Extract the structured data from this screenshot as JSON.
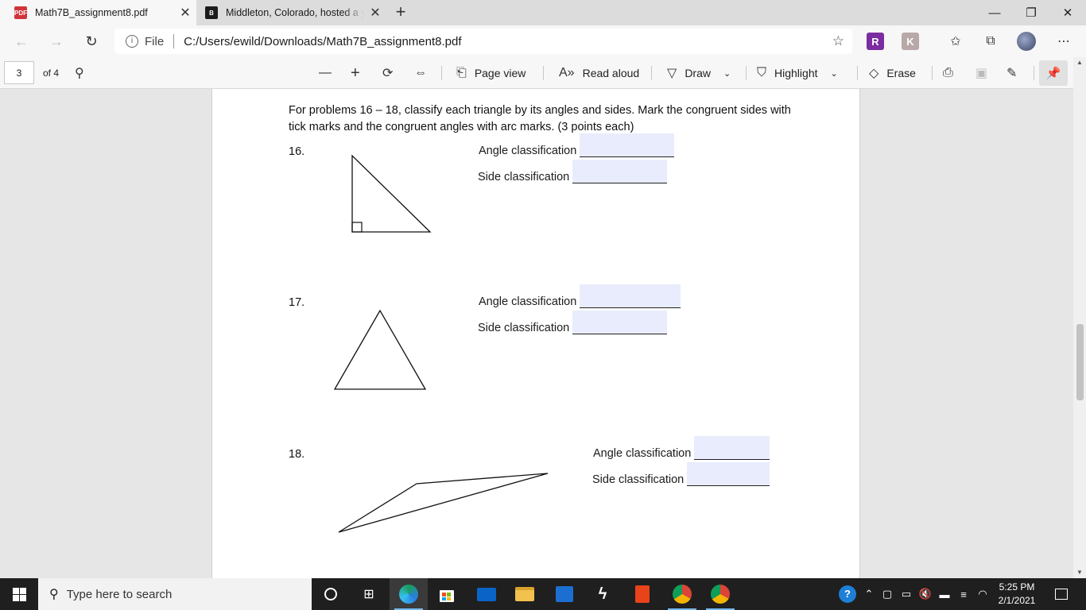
{
  "browser": {
    "tabs": [
      {
        "title": "Math7B_assignment8.pdf",
        "favicon": "pdf-icon",
        "active": true
      },
      {
        "title": "Middleton, Colorado, hosted a y",
        "favicon": "brainly-icon",
        "active": false
      }
    ],
    "address": {
      "scheme_label": "File",
      "url": "C:/Users/ewild/Downloads/Math7B_assignment8.pdf"
    }
  },
  "pdf_toolbar": {
    "page_number": "3",
    "page_count": "of 4",
    "page_view": "Page view",
    "read_aloud": "Read aloud",
    "draw": "Draw",
    "highlight": "Highlight",
    "erase": "Erase"
  },
  "document": {
    "intro": "For problems 16 – 18, classify each triangle by its angles and sides.  Mark the congruent sides with tick marks and the congruent angles with arc marks.  (3 points each)",
    "problems": [
      {
        "number": "16.",
        "angle_label": "Angle classification",
        "side_label": "Side classification",
        "triangle": "right"
      },
      {
        "number": "17.",
        "angle_label": "Angle classification",
        "side_label": "Side classification",
        "triangle": "equilateral"
      },
      {
        "number": "18.",
        "angle_label": "Angle classification",
        "side_label": "Side classification",
        "triangle": "obtuse"
      }
    ]
  },
  "taskbar": {
    "search_placeholder": "Type here to search",
    "time": "5:25 PM",
    "date": "2/1/2021"
  },
  "colors": {
    "form_field_fill": "#e8ecfc",
    "tab_active": "#f7f7f7",
    "taskbar": "#1f1f1f"
  }
}
